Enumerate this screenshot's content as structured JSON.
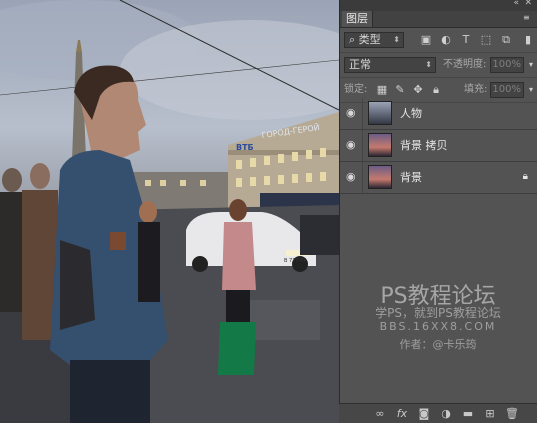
{
  "panel": {
    "tab_label": "图层",
    "filter": {
      "kind": "类型"
    },
    "blend_mode": "正常",
    "opacity_label": "不透明度:",
    "opacity_value": "100%",
    "lock_label": "锁定:",
    "fill_label": "填充:",
    "fill_value": "100%",
    "layers": [
      {
        "name": "人物",
        "visible": true,
        "locked": false
      },
      {
        "name": "背景 拷贝",
        "visible": true,
        "locked": false
      },
      {
        "name": "背景",
        "visible": true,
        "locked": true
      }
    ]
  },
  "photo": {
    "sign_text": "ГОРОД-ГЕРОЙ",
    "bank_text": "ВТБ",
    "plate_text": "В 777 РУ"
  },
  "watermark": {
    "title": "PS教程论坛",
    "subtitle": "学PS，就到PS教程论坛",
    "url": "BBS.16XX8.COM",
    "author": "作者：@卡乐筠"
  },
  "colors": {
    "panel_bg": "#535353",
    "panel_dark": "#424242"
  }
}
